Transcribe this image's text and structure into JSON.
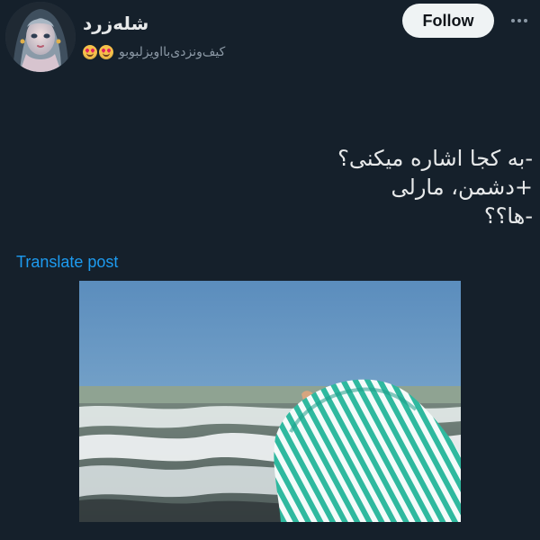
{
  "header": {
    "display_name": "شله‌زرد",
    "handle": "کیف‌ونزدی‌بااویزلبوبو",
    "follow_label": "Follow"
  },
  "post": {
    "lines": [
      "-به کجا اشاره میکنی؟",
      "+دشمن، مارلی",
      "-ها؟؟"
    ],
    "translate_label": "Translate post"
  },
  "icons": {
    "more": "more-icon",
    "emoji": "heart-eyes-icon"
  }
}
